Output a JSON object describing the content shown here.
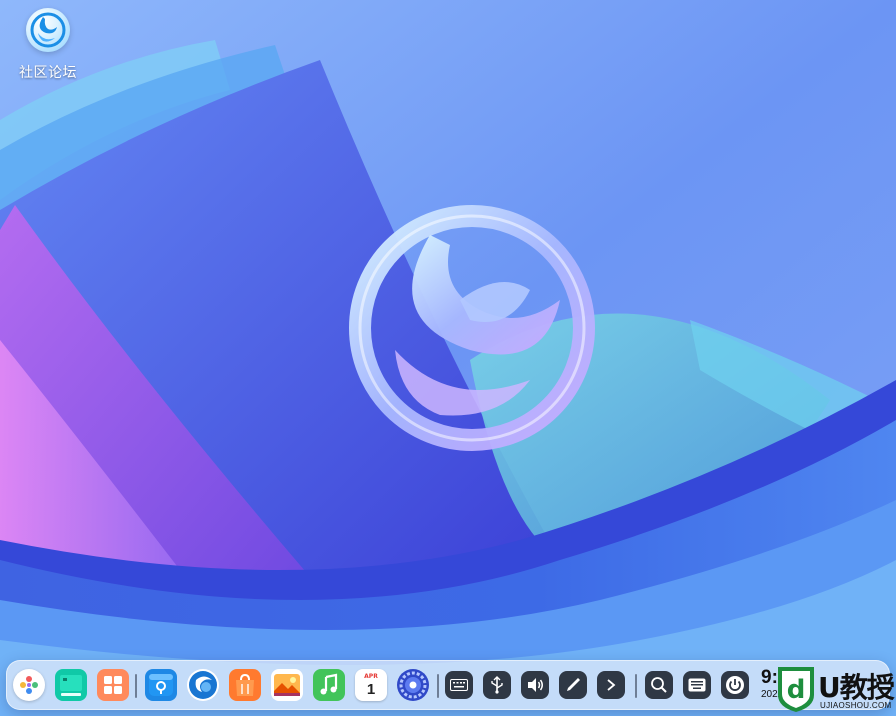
{
  "desktop": {
    "icons": [
      {
        "label": "社区论坛",
        "icon": "deepin-forum-icon"
      }
    ]
  },
  "dock": {
    "apps": [
      {
        "name": "launcher",
        "icon": "launcher-icon"
      },
      {
        "name": "multitasking-view",
        "icon": "multitask-icon"
      },
      {
        "name": "file-manager",
        "icon": "file-manager-icon"
      },
      {
        "name": "app-store",
        "icon": "app-store-icon"
      },
      {
        "name": "browser",
        "icon": "browser-icon"
      },
      {
        "name": "store",
        "icon": "shopping-bag-icon"
      },
      {
        "name": "image-viewer",
        "icon": "photo-icon"
      },
      {
        "name": "music",
        "icon": "music-icon"
      },
      {
        "name": "calendar",
        "icon": "calendar-icon",
        "month": "APR",
        "day": "1"
      },
      {
        "name": "control-center",
        "icon": "gear-icon"
      }
    ],
    "tray": [
      {
        "name": "keyboard-layout",
        "icon": "keyboard-icon"
      },
      {
        "name": "usb",
        "icon": "usb-icon"
      },
      {
        "name": "sound",
        "icon": "volume-icon"
      },
      {
        "name": "screenshot",
        "icon": "pen-icon"
      },
      {
        "name": "expand-tray",
        "icon": "chevron-right-icon"
      },
      {
        "name": "search",
        "icon": "search-icon"
      },
      {
        "name": "onscreen-keyboard",
        "icon": "keyboard-alt-icon"
      },
      {
        "name": "power",
        "icon": "power-icon"
      }
    ],
    "clock": {
      "time": "9:2",
      "date": "2022/4/"
    }
  },
  "watermark": {
    "title": "U教授",
    "subtitle": "UJIAOSHOU.COM"
  }
}
